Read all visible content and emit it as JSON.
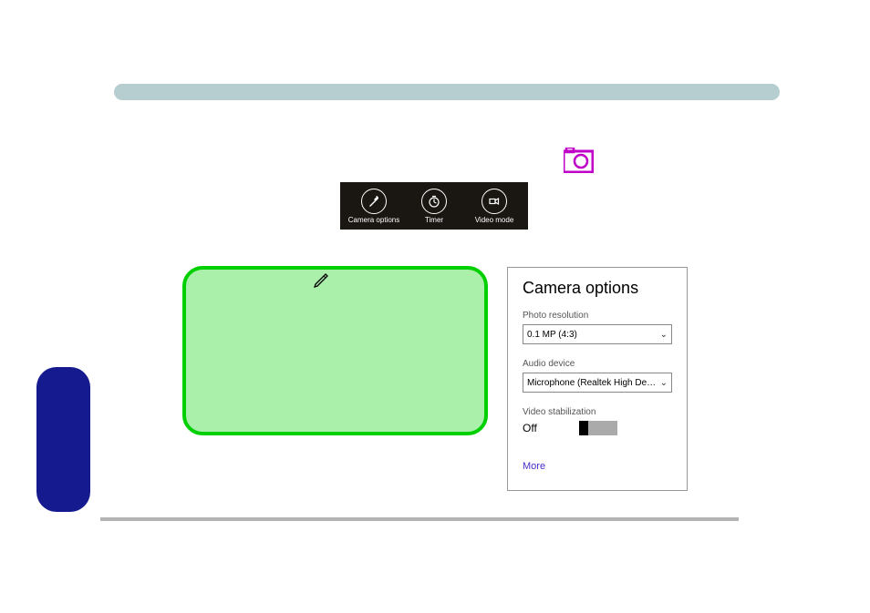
{
  "toolbar": {
    "items": [
      {
        "id": "camera-options",
        "label": "Camera options"
      },
      {
        "id": "timer",
        "label": "Timer"
      },
      {
        "id": "video-mode",
        "label": "Video mode"
      }
    ]
  },
  "cameraOptions": {
    "title": "Camera options",
    "photoResolution": {
      "label": "Photo resolution",
      "selected": "0.1 MP (4:3)"
    },
    "audioDevice": {
      "label": "Audio device",
      "selected": "Microphone (Realtek High Defin..."
    },
    "videoStabilization": {
      "label": "Video stabilization",
      "value": "Off"
    },
    "moreLink": "More"
  }
}
